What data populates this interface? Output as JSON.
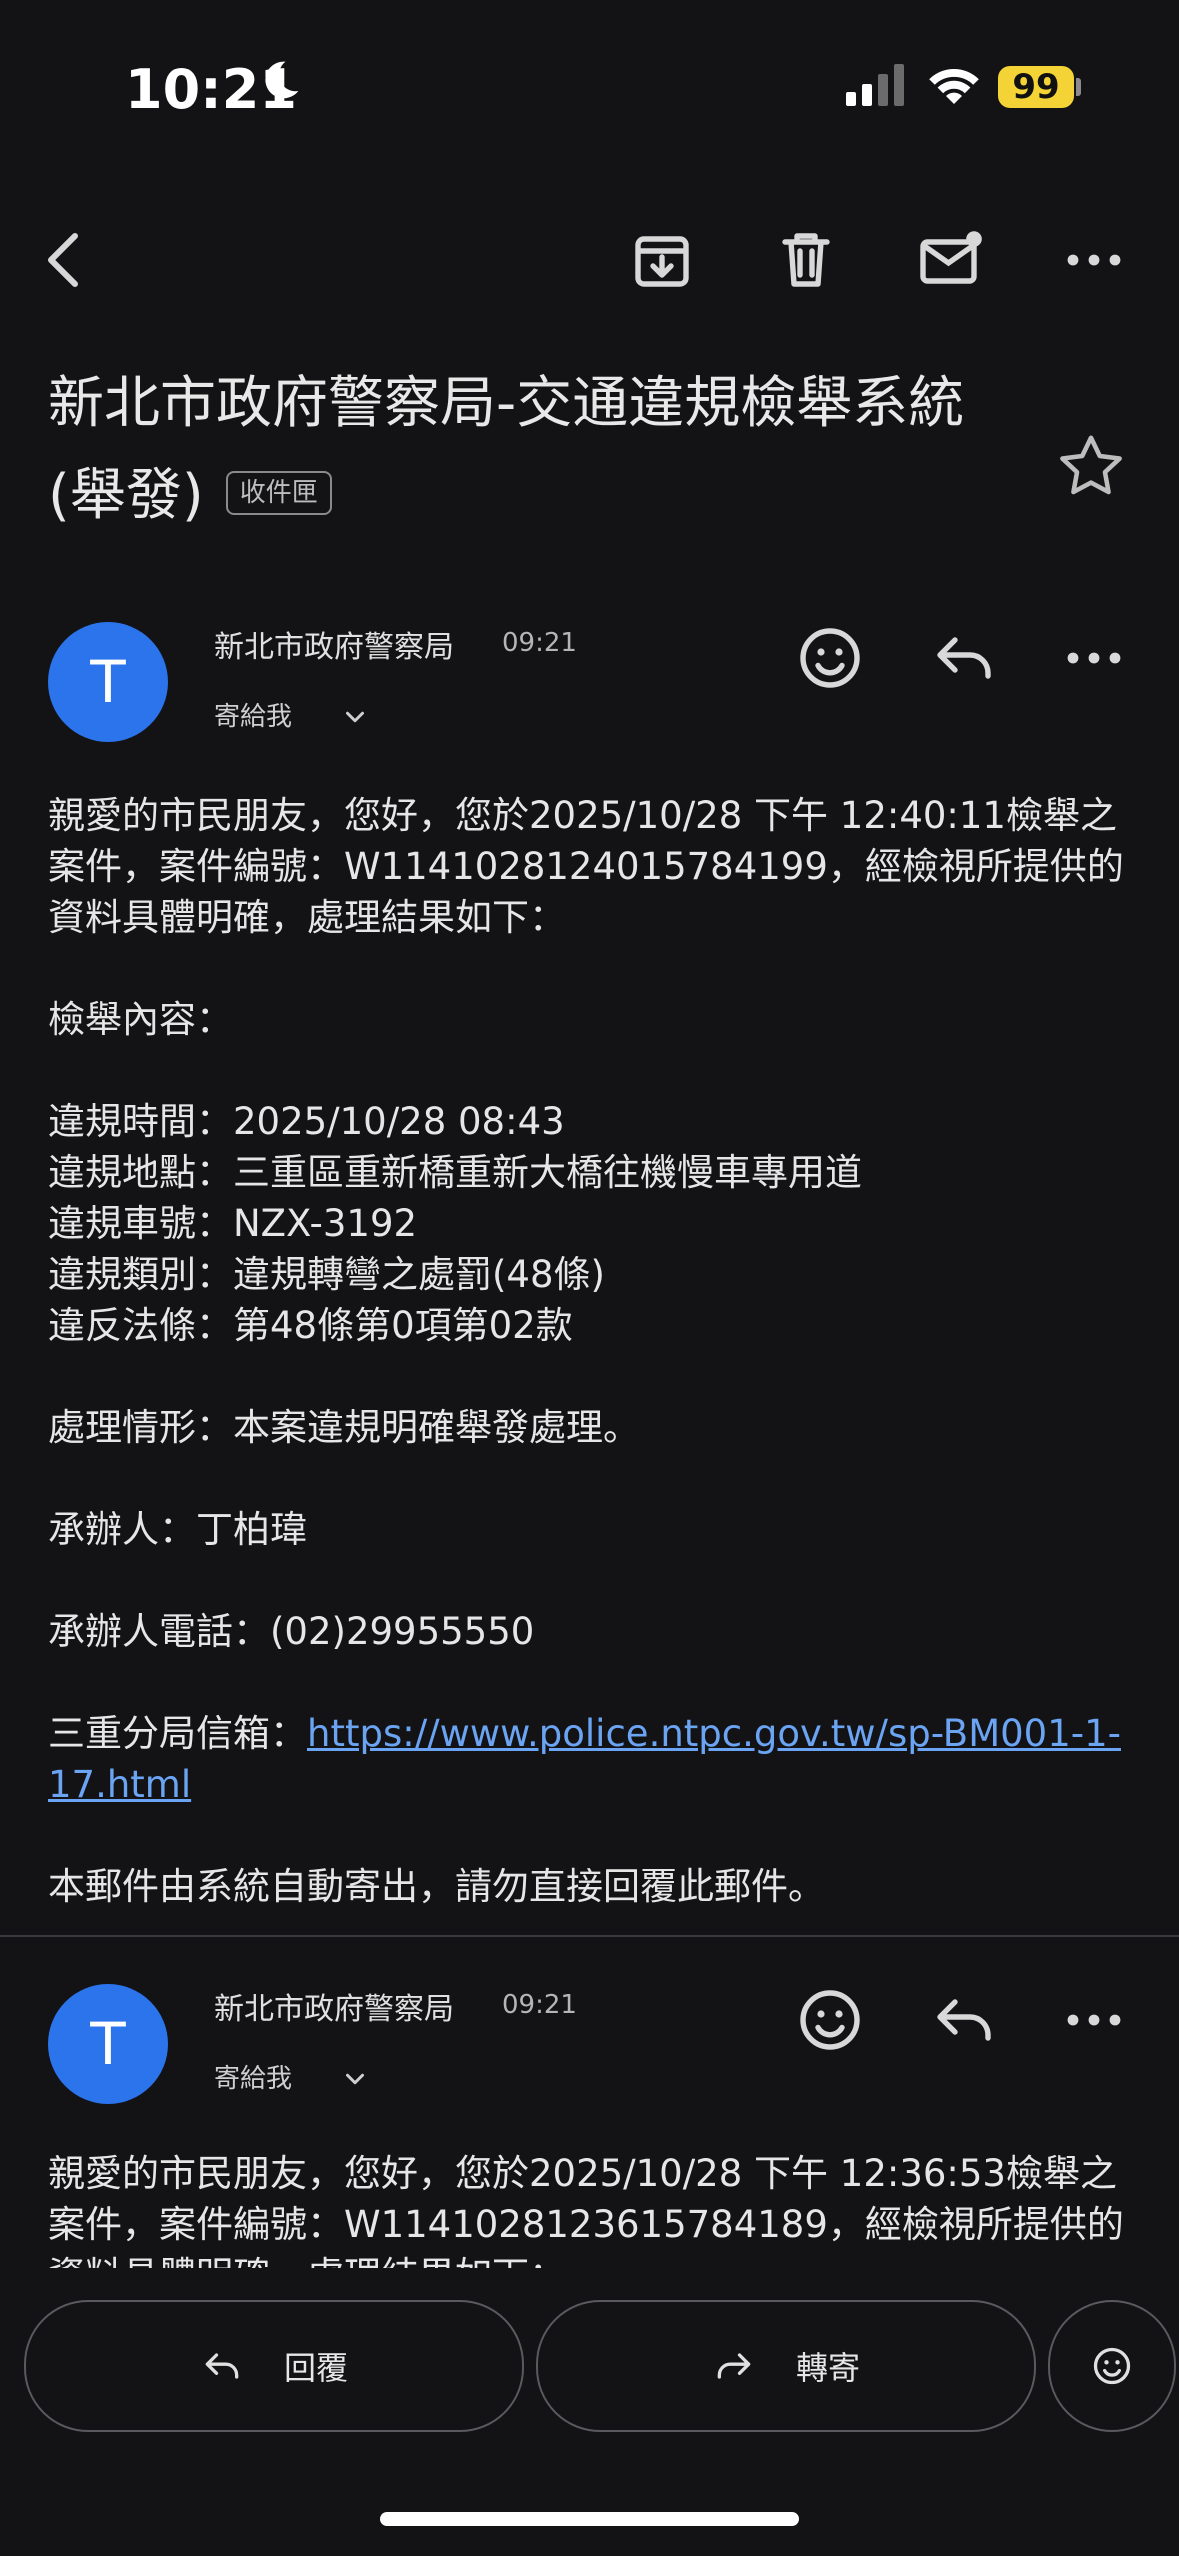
{
  "status_bar": {
    "time": "10:21",
    "battery": "99"
  },
  "email": {
    "subject": "新北市政府警察局-交通違規檢舉系統(舉發)",
    "label": "收件匣"
  },
  "messages": [
    {
      "avatar_letter": "T",
      "sender": "新北市政府警察局",
      "time": "09:21",
      "recipient": "寄給我",
      "body_intro": "親愛的市民朋友，您好，您於2025/10/28 下午 12:40:11檢舉之案件，案件編號：W1141028124015784199，經檢視所提供的資料具體明確，處理結果如下：",
      "report_heading": "檢舉內容：",
      "violation_time": "違規時間：2025/10/28 08:43",
      "violation_place": "違規地點：三重區重新橋重新大橋往機慢車專用道",
      "plate": "違規車號：NZX-3192",
      "category": "違規類別：違規轉彎之處罰(48條)",
      "law": "違反法條：第48條第0項第02款",
      "handling": "處理情形：本案違規明確舉發處理。",
      "officer": "承辦人：丁柏瑋",
      "phone": "承辦人電話：(02)29955550",
      "mailbox_label": "三重分局信箱：",
      "mailbox_url": "https://www.police.ntpc.gov.tw/sp-BM001-1-17.html",
      "footer": "本郵件由系統自動寄出，請勿直接回覆此郵件。"
    },
    {
      "avatar_letter": "T",
      "sender": "新北市政府警察局",
      "time": "09:21",
      "recipient": "寄給我",
      "body_intro": "親愛的市民朋友，您好，您於2025/10/28 下午 12:36:53檢舉之案件，案件編號：W1141028123615784189，經檢視所提供的資料具體明確，處理結果如下："
    }
  ],
  "actions": {
    "reply": "回覆",
    "forward": "轉寄"
  }
}
